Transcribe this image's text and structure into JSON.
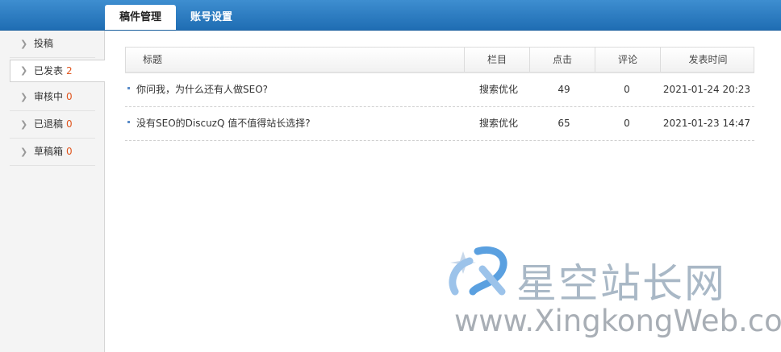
{
  "tabs": [
    {
      "label": "稿件管理",
      "active": true
    },
    {
      "label": "账号设置",
      "active": false
    }
  ],
  "sidebar": {
    "items": [
      {
        "label": "投稿",
        "count": ""
      },
      {
        "label": "已发表",
        "count": "2"
      },
      {
        "label": "审核中",
        "count": "0"
      },
      {
        "label": "已退稿",
        "count": "0"
      },
      {
        "label": "草稿箱",
        "count": "0"
      }
    ]
  },
  "table": {
    "headers": [
      "标题",
      "栏目",
      "点击",
      "评论",
      "发表时间"
    ],
    "rows": [
      {
        "title": "你问我，为什么还有人做SEO?",
        "column": "搜索优化",
        "clicks": "49",
        "comments": "0",
        "time": "2021-01-24 20:23"
      },
      {
        "title": "没有SEO的DiscuzQ 值不值得站长选择?",
        "column": "搜索优化",
        "clicks": "65",
        "comments": "0",
        "time": "2021-01-23 14:47"
      }
    ]
  },
  "watermark": {
    "cn": "星空站长网",
    "en": "www.XingkongWeb.com"
  },
  "colors": {
    "accent": "#2a7cc4",
    "count": "#e0561f"
  }
}
